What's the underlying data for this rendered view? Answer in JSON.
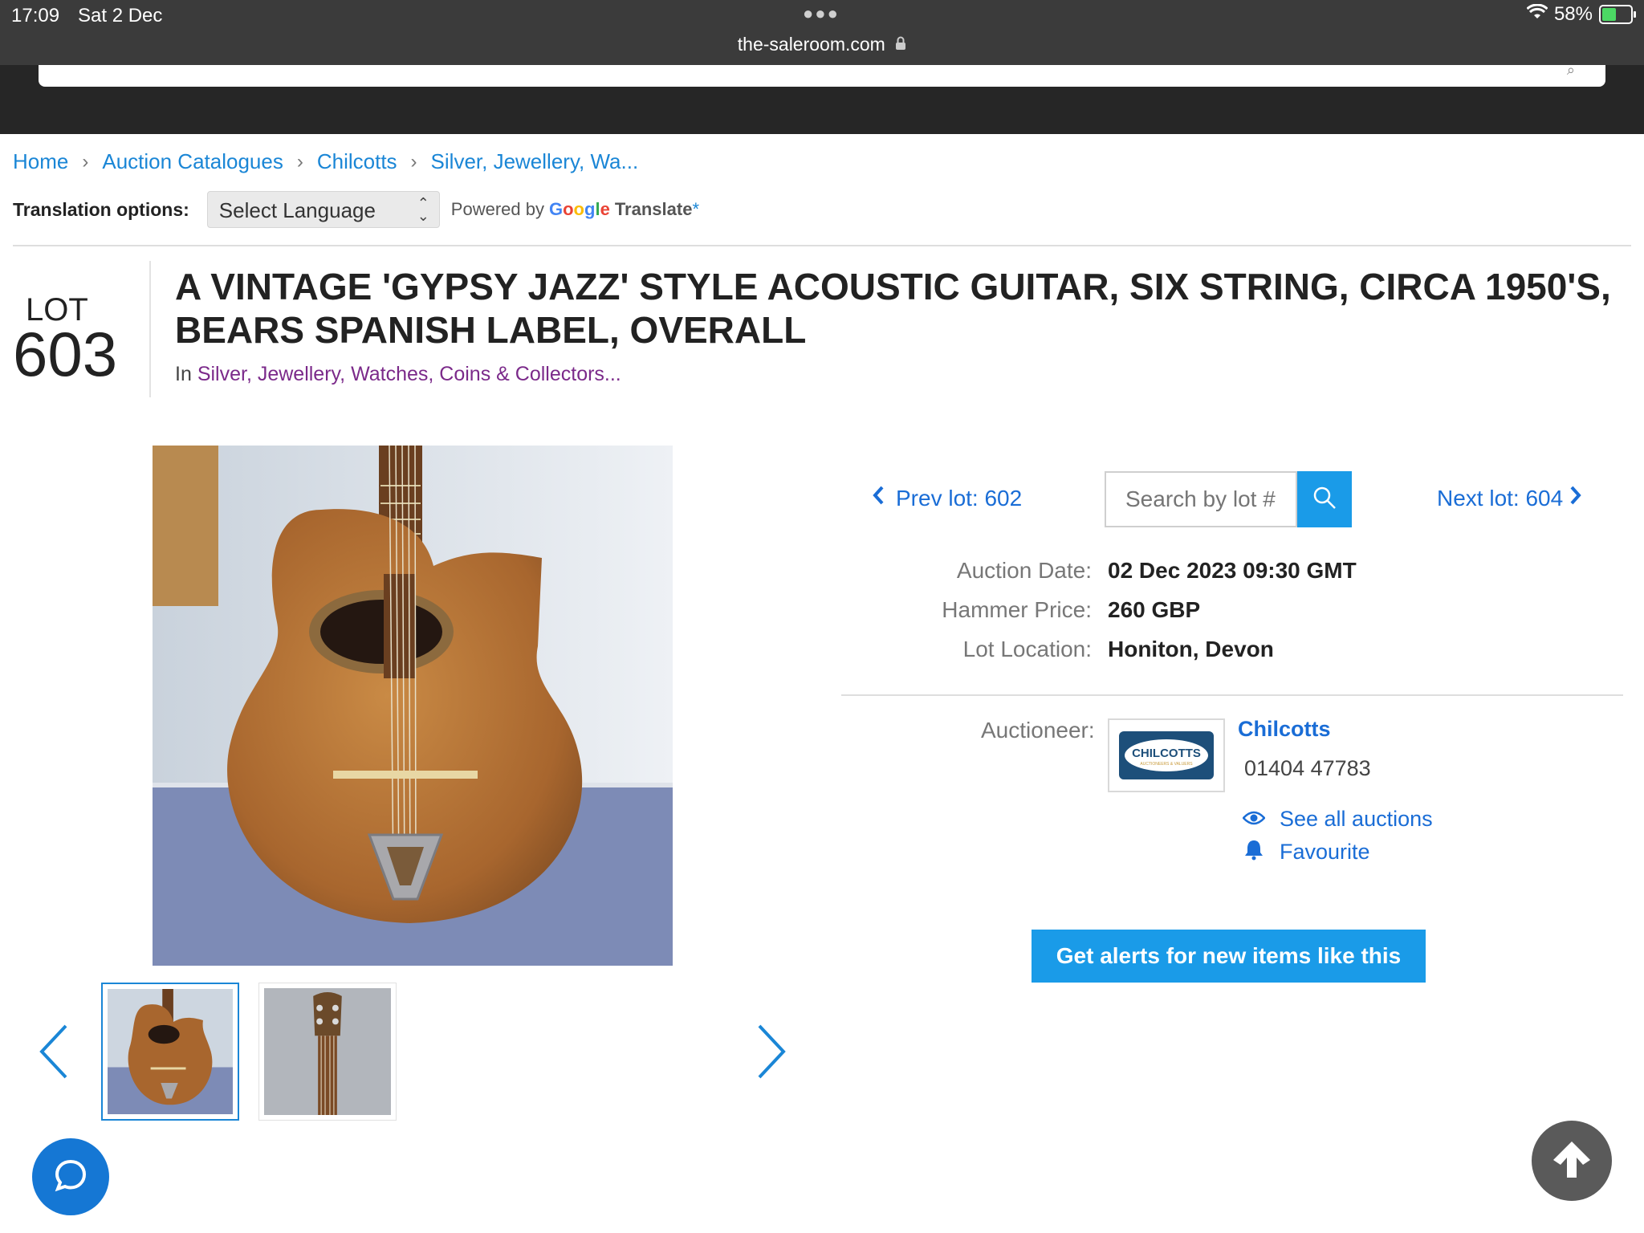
{
  "status_bar": {
    "time": "17:09",
    "date": "Sat 2 Dec",
    "url": "the-saleroom.com",
    "battery": "58%",
    "battery_level": 0.58
  },
  "breadcrumb": [
    "Home",
    "Auction Catalogues",
    "Chilcotts",
    "Silver, Jewellery, Wa..."
  ],
  "translation": {
    "label": "Translation options:",
    "select_value": "Select Language",
    "powered_by": "Powered by",
    "google": [
      "G",
      "o",
      "o",
      "g",
      "l",
      "e"
    ],
    "translate": "Translate",
    "asterisk": "*"
  },
  "lot": {
    "label": "LOT",
    "number": "603",
    "title": "A VINTAGE 'GYPSY JAZZ' STYLE ACOUSTIC GUITAR, SIX STRING, CIRCA 1950'S, BEARS SPANISH LABEL, OVERALL",
    "in_prefix": "In",
    "category": "Silver, Jewellery, Watches, Coins & Collectors..."
  },
  "navigation": {
    "prev_label": "Prev lot: 602",
    "next_label": "Next lot: 604",
    "search_placeholder": "Search by lot #"
  },
  "details": [
    {
      "label": "Auction Date:",
      "value": "02 Dec 2023 09:30 GMT"
    },
    {
      "label": "Hammer Price:",
      "value": "260 GBP"
    },
    {
      "label": "Lot Location:",
      "value": "Honiton, Devon"
    }
  ],
  "auctioneer": {
    "label": "Auctioneer:",
    "name": "Chilcotts",
    "phone": "01404 47783",
    "logo_text": "CHILCOTTS",
    "logo_subtext": "AUCTIONEERS & VALUERS",
    "see_all": "See all auctions",
    "favourite": "Favourite"
  },
  "alert_button": "Get alerts for new items like this",
  "colors": {
    "link": "#1a86d6",
    "accent": "#1a9be8",
    "category": "#7b2a8a",
    "header_dark": "#262626"
  }
}
